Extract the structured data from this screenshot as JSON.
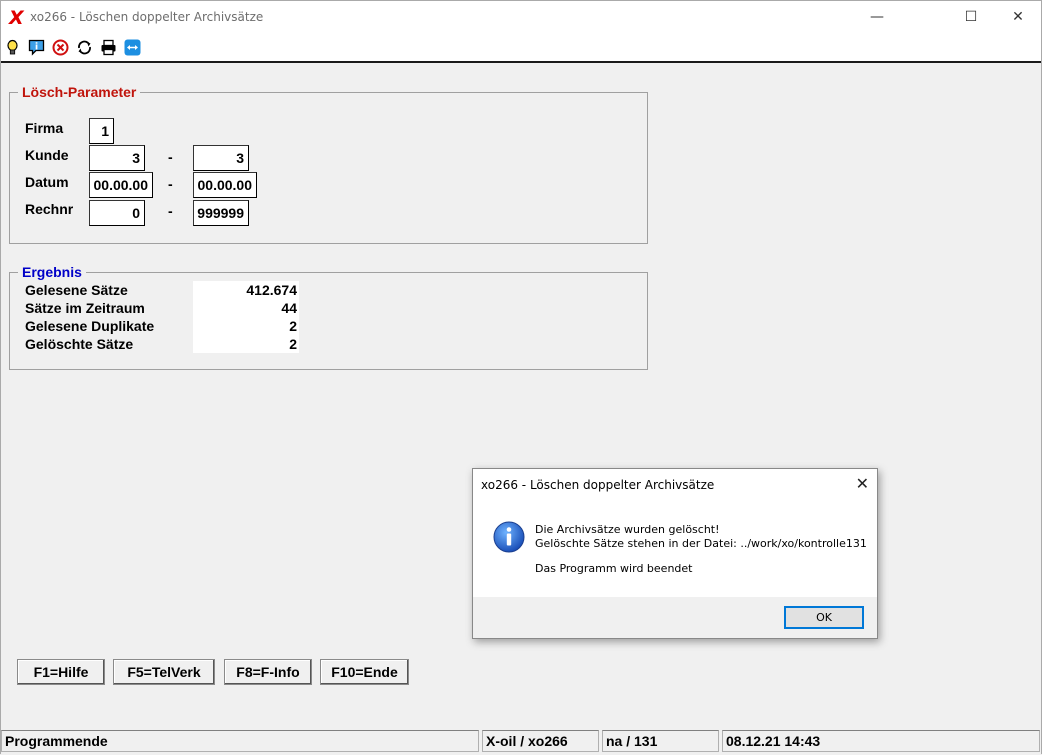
{
  "window": {
    "logo": "X",
    "title": "xo266 - Löschen doppelter Archivsätze",
    "minimize": "—",
    "maximize": "☐",
    "close": "✕"
  },
  "toolbar": {
    "icons": [
      "lightbulb-icon",
      "info-message-icon",
      "cancel-circle-icon",
      "refresh-icon",
      "printer-icon",
      "teamviewer-icon"
    ]
  },
  "params": {
    "legend": "Lösch-Parameter",
    "legend_color": "#c0140c",
    "firma_label": "Firma",
    "firma_value": "1",
    "kunde_label": "Kunde",
    "kunde_from": "3",
    "kunde_to": "3",
    "datum_label": "Datum",
    "datum_from": "00.00.00",
    "datum_to": "00.00.00",
    "rechnr_label": "Rechnr",
    "rechnr_from": "0",
    "rechnr_to": "999999",
    "dash": "-"
  },
  "result": {
    "legend": "Ergebnis",
    "legend_color": "#0000c8",
    "rows": [
      {
        "label": "Gelesene Sätze",
        "value": "412.674"
      },
      {
        "label": "Sätze im Zeitraum",
        "value": "44"
      },
      {
        "label": "Gelesene Duplikate",
        "value": "2"
      },
      {
        "label": "Gelöschte Sätze",
        "value": "2"
      }
    ]
  },
  "buttons": {
    "help": "F1=Hilfe",
    "telverk": "F5=TelVerk",
    "finfo": "F8=F-Info",
    "end": "F10=Ende"
  },
  "status": {
    "message": "Programmende",
    "program": "X-oil / xo266",
    "user": "na / 131",
    "datetime": "08.12.21 14:43"
  },
  "dialog": {
    "title": "xo266 - Löschen doppelter Archivsätze",
    "close": "✕",
    "line1": "Die Archivsätze wurden gelöscht!",
    "line2": "Gelöschte Sätze stehen in der Datei: ../work/xo/kontrolle131",
    "line3": "Das Programm wird beendet",
    "ok": "OK"
  }
}
